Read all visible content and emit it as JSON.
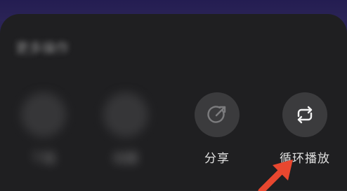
{
  "sheet": {
    "title": "更多操作"
  },
  "actions": [
    {
      "label": "下载",
      "icon": "download-icon"
    },
    {
      "label": "收藏",
      "icon": "collect-icon"
    },
    {
      "label": "分享",
      "icon": "share-icon"
    },
    {
      "label": "循环播放",
      "icon": "loop-icon"
    }
  ],
  "colors": {
    "header": "#2a2355",
    "sheet": "#1f1f21",
    "button": "#3b3b3d",
    "text": "#e0e0e0",
    "annotation_arrow": "#e8472f"
  }
}
